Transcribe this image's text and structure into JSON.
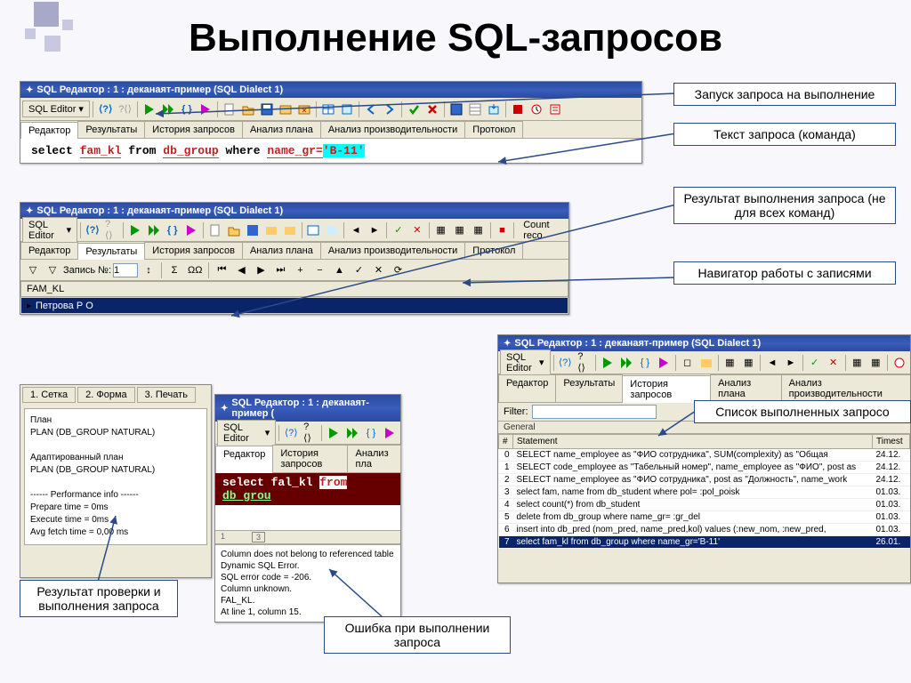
{
  "title": "Выполнение SQL-запросов",
  "callouts": {
    "run": "Запуск запроса на выполнение",
    "text": "Текст запроса (команда)",
    "result": "Результат выполнения  запроса (не для всех команд)",
    "nav": "Навигатор работы с записями",
    "history": "Список выполненных запросо",
    "plan_check": "Результат проверки и выполнения запроса",
    "error": "Ошибка при  выполнении запроса"
  },
  "win": {
    "title": "SQL Редактор : 1 : деканаят-пример (SQL Dialect 1)",
    "sql_editor_btn": "SQL Editor",
    "tabs": [
      "Редактор",
      "Результаты",
      "История запросов",
      "Анализ плана",
      "Анализ производительности",
      "Протокол"
    ],
    "tabs_w4": [
      "Редактор",
      "Результаты",
      "История запросов",
      "Анализ плана",
      "Анализ производительности"
    ],
    "tabs_short": [
      "Редактор",
      "История запросов",
      "Анализ пла"
    ],
    "count_rec": "Count reco"
  },
  "sql1": {
    "select": "select",
    "fam_kl": "fam_kl",
    "from": "from",
    "db_group": "db_group",
    "where": "where",
    "name_gr": "name_gr=",
    "val": "'B-11'"
  },
  "sql2": {
    "select": "select",
    "fal_kl": "fal_kl",
    "from": "from",
    "db_grou": "db_grou"
  },
  "record": {
    "label": "Запись №:",
    "value": "1"
  },
  "grid": {
    "col": "FAM_KL",
    "row1": "Петрова Р О"
  },
  "bottom_tabs": [
    "1. Сетка",
    "2. Форма",
    "3. Печать"
  ],
  "plan": "План\nPLAN (DB_GROUP NATURAL)\n\nАдаптированный план\nPLAN (DB_GROUP NATURAL)\n\n------ Performance info ------\nPrepare time = 0ms\nExecute time = 0ms\nAvg fetch time = 0,00 ms",
  "ruler": [
    "1",
    "3"
  ],
  "error_text": "Column does not belong to referenced table\nDynamic SQL Error.\nSQL error code = -206.\nColumn unknown.\nFAL_KL.\nAt line 1, column 15.",
  "filter_label": "Filter:",
  "general_label": "General",
  "hist": {
    "cols": [
      "#",
      "Statement",
      "Timest"
    ],
    "rows": [
      {
        "n": "0",
        "stmt": "SELECT name_employee as \"ФИО сотрудника\",   SUM(complexity) as \"Общая",
        "t": "24.12."
      },
      {
        "n": "1",
        "stmt": "SELECT code_employee as \"Табельный номер\", name_employee as \"ФИО\",   post as",
        "t": "24.12."
      },
      {
        "n": "2",
        "stmt": "SELECT name_employee as \"ФИО сотрудника\", post as \"Должность\",   name_work",
        "t": "24.12."
      },
      {
        "n": "3",
        "stmt": "select fam, name from db_student where pol= :pol_poisk",
        "t": "01.03."
      },
      {
        "n": "4",
        "stmt": "select count(*) from db_student",
        "t": "01.03."
      },
      {
        "n": "5",
        "stmt": "delete from db_group where name_gr= :gr_del",
        "t": "01.03."
      },
      {
        "n": "6",
        "stmt": "insert into db_pred (nom_pred, name_pred,kol) values (:new_nom, :new_pred,",
        "t": "01.03."
      },
      {
        "n": "7",
        "stmt": "select fam_kl from db_group where name_gr='B-11'",
        "t": "26.01."
      }
    ]
  }
}
